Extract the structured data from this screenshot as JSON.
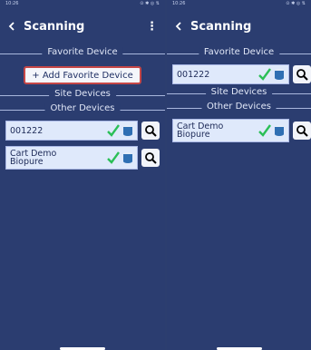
{
  "left_panel": {
    "status": {
      "time": "10:26",
      "icons": "⊙ ✱ ◎ ⇅"
    },
    "header": {
      "title": "Scanning",
      "more_label": "⋮"
    },
    "sections": {
      "favorite": "Favorite Device",
      "site": "Site Devices",
      "other": "Other Devices"
    },
    "favorite_button": "+ Add Favorite Device",
    "devices": [
      {
        "name": "001222"
      },
      {
        "name": "Cart Demo\nBiopure"
      }
    ]
  },
  "right_panel": {
    "status": {
      "time": "10:26",
      "icons": "⊙ ✱ ◎ ⇅"
    },
    "header": {
      "title": "Scanning"
    },
    "sections": {
      "favorite": "Favorite Device",
      "site": "Site Devices",
      "other": "Other Devices"
    },
    "favorite_device": {
      "name": "001222"
    },
    "devices": [
      {
        "name": "Cart Demo\nBiopure"
      }
    ]
  },
  "icons": {
    "back": "chevron-left-icon",
    "check": "check-icon",
    "database": "database-icon",
    "search": "search-icon"
  },
  "colors": {
    "background": "#2b3d70",
    "card": "#dfe9fb",
    "check": "#2bbf57",
    "accent_border": "#c64747"
  }
}
